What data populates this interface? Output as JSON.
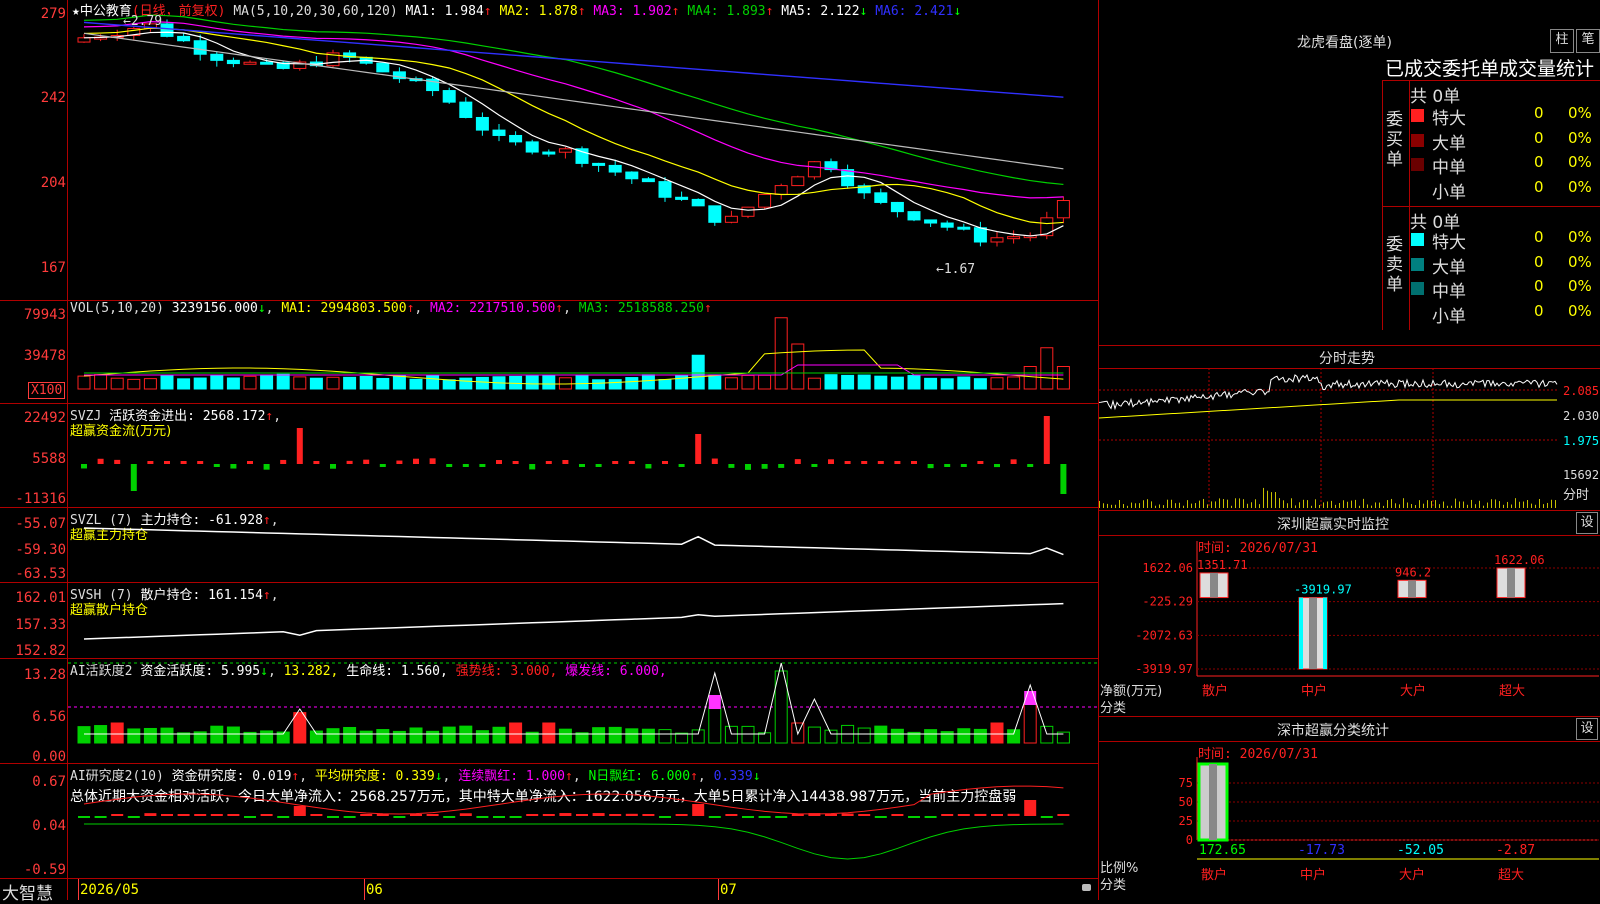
{
  "app": {
    "name": "大智慧"
  },
  "stock": {
    "name": "★中公教育",
    "mode": "(日线，前复权)"
  },
  "colors": {
    "up": "#ff2020",
    "down": "#00ffff",
    "bg": "#000000",
    "grid": "#b00000",
    "ma_white": "#ffffff",
    "ma_yellow": "#ffff00",
    "ma_magenta": "#ff00ff",
    "ma_green": "#00d000",
    "ma_gray": "#bbbbbb",
    "ma_blue": "#3030ff"
  },
  "main_panel": {
    "ma_header": "MA(5,10,20,30,60,120)",
    "ma_items": [
      {
        "label": "MA1: 1.984",
        "arrow": "↑",
        "color": "#ffffff"
      },
      {
        "label": "MA2: 1.878",
        "arrow": "↑",
        "color": "#ffff00"
      },
      {
        "label": "MA3: 1.902",
        "arrow": "↑",
        "color": "#ff00ff"
      },
      {
        "label": "MA4: 1.893",
        "arrow": "↑",
        "color": "#00d000"
      },
      {
        "label": "MA5: 2.122",
        "arrow": "↓",
        "color": "#ffffff"
      },
      {
        "label": "MA6: 2.421",
        "arrow": "↓",
        "color": "#3030ff"
      }
    ],
    "y_ticks": [
      "279",
      "242",
      "204",
      "167"
    ],
    "high_label": "2.79",
    "low_label": "1.67"
  },
  "vol_panel": {
    "header": "VOL(5,10,20)",
    "value": "3239156.000",
    "v_arrow": "↓",
    "ma1": "MA1: 2994803.500",
    "ma1_arrow": "↑",
    "ma2": "MA2: 2217510.500",
    "ma2_arrow": "↑",
    "ma3": "MA3: 2518588.250",
    "ma3_arrow": "↑",
    "y_ticks": [
      "79943",
      "39478"
    ],
    "unit": "X100"
  },
  "svzj_panel": {
    "header": "SVZJ",
    "label": "活跃资金进出: 2568.172",
    "arrow": "↑",
    "subtitle": "超赢资金流(万元)",
    "y_ticks": [
      "22492",
      "5588",
      "-11316"
    ]
  },
  "svzl_panel": {
    "header": "SVZL (7)",
    "label": "主力持仓: -61.928",
    "arrow": "↑",
    "subtitle": "超赢主力持仓",
    "y_ticks": [
      "-55.07",
      "-59.30",
      "-63.53"
    ]
  },
  "svsh_panel": {
    "header": "SVSH (7)",
    "label": "散户持仓: 161.154",
    "arrow": "↑",
    "subtitle": "超赢散户持仓",
    "y_ticks": [
      "162.01",
      "157.33",
      "152.82"
    ]
  },
  "ai_active_panel": {
    "header": "AI活跃度2",
    "label": "资金活跃度: 5.995",
    "arrow": "↓",
    "v2": "13.282,",
    "life": "生命线: 1.560,",
    "strong": "强势线: 3.000,",
    "burst": "爆发线: 6.000,",
    "y_ticks": [
      "13.28",
      "6.56",
      "0.00"
    ]
  },
  "ai_research_panel": {
    "header": "AI研究度2(10)",
    "label": "资金研究度: 0.019",
    "arrow": "↑",
    "avg": "平均研究度: 0.339",
    "avg_arrow": "↓",
    "cont": "连续飘红: 1.000",
    "cont_arrow": "↑",
    "n": "N日飘红: 6.000",
    "n_arrow": "↑",
    "last": "0.339",
    "last_arrow": "↓",
    "y_ticks": [
      "0.67",
      "0.04",
      "-0.59"
    ],
    "summary": "总体近期大资金相对活跃，今日大单净流入：2568.257万元，其中特大单净流入：1622.056万元，大单5日累计净入14438.987万元，当前主力控盘弱"
  },
  "x_axis": {
    "labels": [
      "2026/05",
      "06",
      "07"
    ]
  },
  "right_panel": {
    "dragon_title": "龙虎看盘(逐单)",
    "btn_zhu": "柱",
    "btn_bi": "笔",
    "stats_title": "已成交委托单成交量统计",
    "buy_side": {
      "side": "委买单",
      "total": "共 0单",
      "rows": [
        {
          "label": "特大",
          "count": "0",
          "pct": "0%",
          "color": "#ff2020"
        },
        {
          "label": "大单",
          "count": "0",
          "pct": "0%",
          "color": "#8b0000"
        },
        {
          "label": "中单",
          "count": "0",
          "pct": "0%",
          "color": "#6a0000"
        },
        {
          "label": "小单",
          "count": "0",
          "pct": "0%",
          "color": ""
        }
      ]
    },
    "sell_side": {
      "side": "委卖单",
      "total": "共 0单",
      "rows": [
        {
          "label": "特大",
          "count": "0",
          "pct": "0%",
          "color": "#00ffff"
        },
        {
          "label": "大单",
          "count": "0",
          "pct": "0%",
          "color": "#008080"
        },
        {
          "label": "中单",
          "count": "0",
          "pct": "0%",
          "color": "#007070"
        },
        {
          "label": "小单",
          "count": "0",
          "pct": "0%",
          "color": ""
        }
      ]
    },
    "intraday": {
      "title": "分时走势",
      "y_ticks": [
        "2.085",
        "2.030",
        "1.975",
        "15692"
      ],
      "x_label": "分时"
    },
    "sz_monitor": {
      "title": "深圳超赢实时监控",
      "btn": "设",
      "time": "时间: 2026/07/31",
      "y_ticks": [
        "1622.06",
        "-225.29",
        "-2072.63",
        "-3919.97"
      ],
      "y_unit": "净额(万元)",
      "x_title": "分类",
      "chart_data": {
        "type": "bar",
        "categories": [
          "散户",
          "中户",
          "大户",
          "超大"
        ],
        "values": [
          1351.71,
          -3919.97,
          946.2,
          1622.06
        ],
        "value_labels": [
          "1351.71",
          "-3919.97",
          "946.2",
          "1622.06"
        ],
        "ylim": [
          -3919.97,
          1622.06
        ]
      }
    },
    "sz_classify": {
      "title": "深市超赢分类统计",
      "btn": "设",
      "time": "时间: 2026/07/31",
      "y_ticks": [
        "75",
        "50",
        "25",
        "0"
      ],
      "y_unit": "比例%",
      "x_title": "分类",
      "chart_data": {
        "type": "bar",
        "categories": [
          "散户",
          "中户",
          "大户",
          "超大"
        ],
        "values": [
          172.65,
          -17.73,
          -52.05,
          -2.87
        ],
        "value_labels": [
          "172.65",
          "-17.73",
          "-52.05",
          "-2.87"
        ],
        "ylim": [
          0,
          75
        ]
      }
    }
  }
}
